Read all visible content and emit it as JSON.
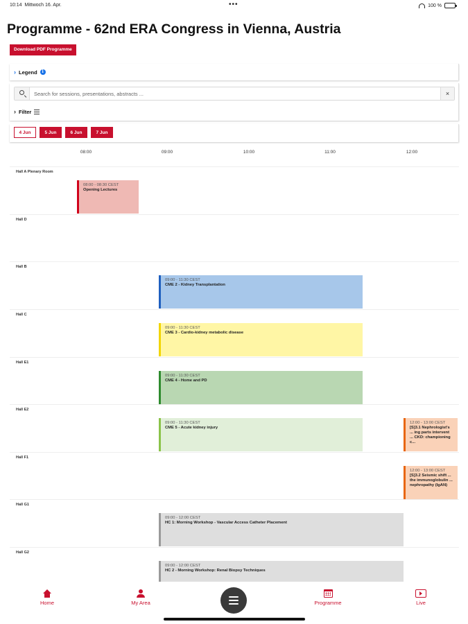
{
  "status_bar": {
    "time": "10:14",
    "date": "Mittwoch 16. Apr.",
    "dots": "•••",
    "battery": "100 %"
  },
  "title": "Programme - 62nd ERA Congress in Vienna, Austria",
  "download_pdf_label": "Download PDF Programme",
  "legend_label": "Legend",
  "search": {
    "placeholder": "Search for sessions, presentations, abstracts ...",
    "value": ""
  },
  "filter_label": "Filter",
  "days": [
    {
      "label": "4 Jun",
      "active": true
    },
    {
      "label": "5 Jun",
      "active": false
    },
    {
      "label": "6 Jun",
      "active": false
    },
    {
      "label": "7 Jun",
      "active": false
    }
  ],
  "times": [
    "08:00",
    "09:00",
    "10:00",
    "11:00",
    "12:00"
  ],
  "halls": [
    {
      "name": "Hall A Plenary Room"
    },
    {
      "name": "Hall D"
    },
    {
      "name": "Hall B"
    },
    {
      "name": "Hall C"
    },
    {
      "name": "Hall E1"
    },
    {
      "name": "Hall E2"
    },
    {
      "name": "Hall F1"
    },
    {
      "name": "Hall G1"
    },
    {
      "name": "Hall G2"
    }
  ],
  "sessions": [
    {
      "hall": "Hall A Plenary Room",
      "time": "08:00 - 08:30 CEST",
      "title": "Opening Lectures",
      "color": "#efb9b4",
      "border": "#d0021b"
    },
    {
      "hall": "Hall B",
      "time": "09:00 - 11:30 CEST",
      "title": "CME 2 - Kidney Transplantation",
      "color": "#a7c7ea",
      "border": "#1f5fbf"
    },
    {
      "hall": "Hall C",
      "time": "09:00 - 11:30 CEST",
      "title": "CME 3 - Cardio-kidney metabolic disease",
      "color": "#fff6a5",
      "border": "#f2d500"
    },
    {
      "hall": "Hall E1",
      "time": "09:00 - 11:30 CEST",
      "title": "CME 4 - Home and PD",
      "color": "#b9d7b2",
      "border": "#2e8b2e"
    },
    {
      "hall": "Hall E2",
      "time": "09:00 - 11:30 CEST",
      "title": "CME 5 - Acute kidney injury",
      "color": "#e1efd9",
      "border": "#8bc34a"
    },
    {
      "hall": "Hall E2",
      "time": "12:00 - 13:00 CEST",
      "title": "[S]3.1 Nephrologist's ... ing parts intervent ... CKD: championing c...",
      "color": "#fad2b8",
      "border": "#e8660f"
    },
    {
      "hall": "Hall F1",
      "time": "12:00 - 13:00 CEST",
      "title": "[S]3.2 Seismic shift ... the immunoglobulin ... nephropathy (IgAN)",
      "color": "#fad2b8",
      "border": "#e8660f"
    },
    {
      "hall": "Hall G1",
      "time": "09:00 - 12:00 CEST",
      "title": "HC 1: Morning Workshop - Vascular Access Catheter Placement",
      "color": "#dedede",
      "border": "#9a9a9a"
    },
    {
      "hall": "Hall G2",
      "time": "09:00 - 12:00 CEST",
      "title": "HC 2 - Morning Workshop: Renal Biopsy Techniques",
      "color": "#dedede",
      "border": "#9a9a9a"
    }
  ],
  "nav": {
    "home": "Home",
    "my_area": "My Area",
    "programme": "Programme",
    "live": "Live"
  }
}
